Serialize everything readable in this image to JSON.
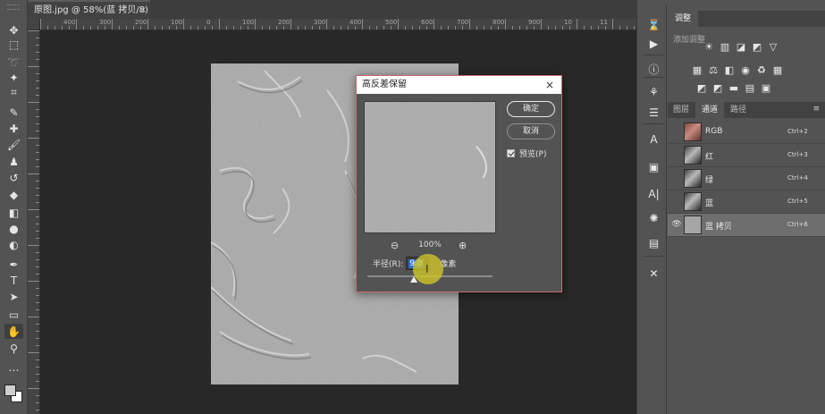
{
  "document": {
    "tab_title": "原图.jpg @ 58%(蓝 拷贝/8) *",
    "close_glyph": "×",
    "ruler_labels": [
      "400",
      "300",
      "200",
      "100",
      "0",
      "100",
      "200",
      "300",
      "400",
      "500",
      "600",
      "700",
      "800",
      "900",
      "10",
      "11"
    ]
  },
  "toolbar": {
    "tools": [
      {
        "name": "move-tool",
        "glyph": "✥"
      },
      {
        "name": "marquee-tool",
        "glyph": "⬚"
      },
      {
        "name": "lasso-tool",
        "glyph": "➰"
      },
      {
        "name": "magic-wand-tool",
        "glyph": "✦"
      },
      {
        "name": "crop-tool",
        "glyph": "⌗"
      },
      {
        "name": "eyedropper-tool",
        "glyph": "✎"
      },
      {
        "name": "healing-brush-tool",
        "glyph": "✚"
      },
      {
        "name": "brush-tool",
        "glyph": "🖌"
      },
      {
        "name": "clone-stamp-tool",
        "glyph": "♟"
      },
      {
        "name": "history-brush-tool",
        "glyph": "↺"
      },
      {
        "name": "eraser-tool",
        "glyph": "◆"
      },
      {
        "name": "gradient-tool",
        "glyph": "◧"
      },
      {
        "name": "blur-tool",
        "glyph": "●"
      },
      {
        "name": "dodge-tool",
        "glyph": "◐"
      },
      {
        "name": "pen-tool",
        "glyph": "✒"
      },
      {
        "name": "type-tool",
        "glyph": "T"
      },
      {
        "name": "path-selection-tool",
        "glyph": "➤"
      },
      {
        "name": "rectangle-tool",
        "glyph": "▭"
      },
      {
        "name": "hand-tool",
        "glyph": "✋"
      },
      {
        "name": "zoom-tool",
        "glyph": "⚲"
      },
      {
        "name": "more-tools",
        "glyph": "…"
      }
    ]
  },
  "dialog": {
    "title": "高反差保留",
    "close_glyph": "×",
    "ok_label": "确定",
    "cancel_label": "取消",
    "preview_label": "预览(P)",
    "zoom_out_glyph": "⊖",
    "zoom_in_glyph": "⊕",
    "zoom_value": "100%",
    "radius_label": "半径(R):",
    "radius_value": "9.0",
    "radius_unit": "像素",
    "radius_slider_fraction": 0.37
  },
  "right_strip": {
    "icons": [
      {
        "name": "history-icon",
        "glyph": "⌛"
      },
      {
        "name": "play-icon",
        "glyph": "▶"
      },
      {
        "name": "info-icon",
        "glyph": "ⓘ"
      },
      {
        "name": "brush-settings-icon",
        "glyph": "⚘"
      },
      {
        "name": "properties-icon",
        "glyph": "☰"
      },
      {
        "name": "character-icon",
        "glyph": "A"
      },
      {
        "name": "folder-icon",
        "glyph": "▣"
      },
      {
        "name": "paragraph-icon",
        "glyph": "A|"
      },
      {
        "name": "styles-icon",
        "glyph": "✺"
      },
      {
        "name": "libraries-icon",
        "glyph": "▤"
      },
      {
        "name": "tools-icon",
        "glyph": "✕"
      }
    ]
  },
  "adjustments": {
    "tab_label": "调整",
    "add_label": "添加调整",
    "row1": [
      "☀",
      "▥",
      "◪",
      "◩",
      "▽"
    ],
    "row2": [
      "▦",
      "⚖",
      "◧",
      "◉",
      "♻",
      "▦"
    ],
    "row3": [
      "◩",
      "◩",
      "▬",
      "▤",
      "▣"
    ]
  },
  "channels_panel": {
    "tabs": [
      "图层",
      "通道",
      "路径"
    ],
    "menu_glyph": "≡",
    "rows": [
      {
        "name": "RGB",
        "shortcut": "Ctrl+2",
        "eye": "",
        "thumb": "color"
      },
      {
        "name": "红",
        "shortcut": "Ctrl+3",
        "eye": "",
        "thumb": "gray"
      },
      {
        "name": "绿",
        "shortcut": "Ctrl+4",
        "eye": "",
        "thumb": "gray"
      },
      {
        "name": "蓝",
        "shortcut": "Ctrl+5",
        "eye": "",
        "thumb": "gray"
      },
      {
        "name": "蓝 拷贝",
        "shortcut": "Ctrl+6",
        "eye": "👁",
        "thumb": "flat"
      }
    ]
  }
}
